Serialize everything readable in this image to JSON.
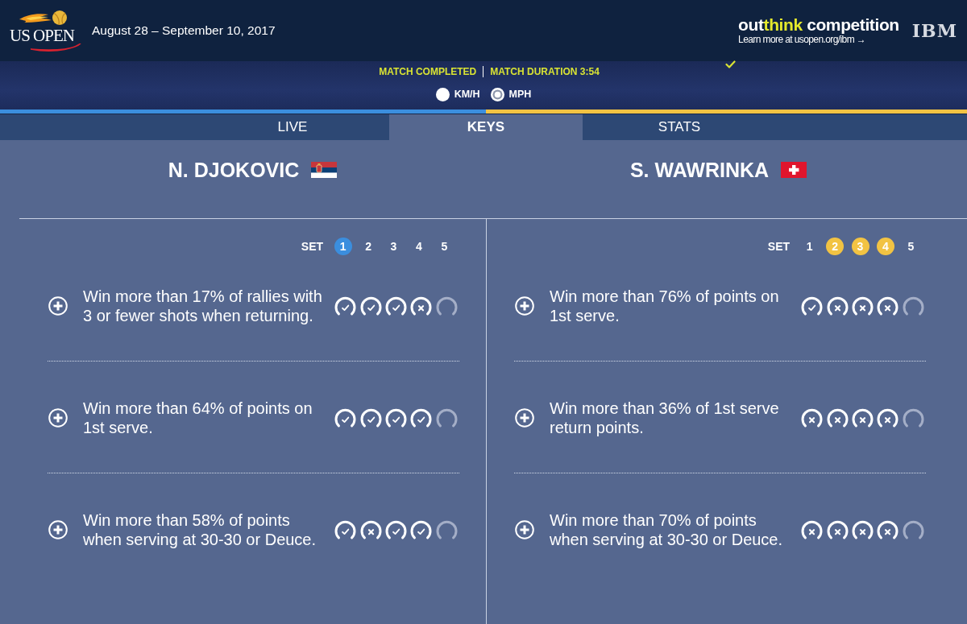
{
  "header": {
    "logo_text": "US OPEN",
    "dates": "August 28 – September 10, 2017",
    "promo": {
      "title_parts": [
        {
          "text": "out",
          "highlight": false
        },
        {
          "text": "think",
          "highlight": true
        },
        {
          "text": " competition",
          "highlight": false
        }
      ],
      "link": "Learn more at usopen.org/ibm →",
      "sponsor": "IBM"
    }
  },
  "match_bar": {
    "status": "MATCH COMPLETED",
    "duration": "MATCH DURATION 3:54",
    "units": [
      {
        "label": "KM/H",
        "selected": false
      },
      {
        "label": "MPH",
        "selected": true
      }
    ]
  },
  "tabs": [
    {
      "label": "LIVE",
      "selected": false
    },
    {
      "label": "KEYS",
      "selected": true
    },
    {
      "label": "STATS",
      "selected": false
    }
  ],
  "players": [
    {
      "name": "N. DJOKOVIC",
      "flag": {
        "kind": "serbia"
      },
      "color": "#3b8ede",
      "set_label": "SET",
      "sets": [
        {
          "label": "1",
          "won": true
        },
        {
          "label": "2",
          "won": false
        },
        {
          "label": "3",
          "won": false
        },
        {
          "label": "4",
          "won": false
        },
        {
          "label": "5",
          "won": false
        }
      ],
      "keys": [
        {
          "text": "Win more than 17% of rallies with 3 or fewer shots when returning.",
          "results": [
            {
              "kind": "met"
            },
            {
              "kind": "met"
            },
            {
              "kind": "met"
            },
            {
              "kind": "missed"
            },
            {
              "kind": "pending"
            }
          ]
        },
        {
          "text": "Win more than 64% of points on 1st serve.",
          "results": [
            {
              "kind": "met"
            },
            {
              "kind": "met"
            },
            {
              "kind": "met"
            },
            {
              "kind": "met"
            },
            {
              "kind": "pending"
            }
          ]
        },
        {
          "text": "Win more than 58% of points when serving at 30-30 or Deuce.",
          "results": [
            {
              "kind": "met"
            },
            {
              "kind": "missed"
            },
            {
              "kind": "met"
            },
            {
              "kind": "met"
            },
            {
              "kind": "pending"
            }
          ]
        }
      ]
    },
    {
      "name": "S. WAWRINKA",
      "flag": {
        "kind": "switzerland"
      },
      "color": "#f2c343",
      "set_label": "SET",
      "sets": [
        {
          "label": "1",
          "won": false
        },
        {
          "label": "2",
          "won": true
        },
        {
          "label": "3",
          "won": true
        },
        {
          "label": "4",
          "won": true
        },
        {
          "label": "5",
          "won": false
        }
      ],
      "keys": [
        {
          "text": "Win more than 76% of points on 1st serve.",
          "results": [
            {
              "kind": "met"
            },
            {
              "kind": "missed"
            },
            {
              "kind": "missed"
            },
            {
              "kind": "missed"
            },
            {
              "kind": "pending"
            }
          ]
        },
        {
          "text": "Win more than 36% of 1st serve return points.",
          "results": [
            {
              "kind": "missed"
            },
            {
              "kind": "missed"
            },
            {
              "kind": "missed"
            },
            {
              "kind": "missed"
            },
            {
              "kind": "pending"
            }
          ]
        },
        {
          "text": "Win more than 70% of points when serving at 30-30 or Deuce.",
          "results": [
            {
              "kind": "missed"
            },
            {
              "kind": "missed"
            },
            {
              "kind": "missed"
            },
            {
              "kind": "missed"
            },
            {
              "kind": "pending"
            }
          ]
        }
      ]
    }
  ]
}
